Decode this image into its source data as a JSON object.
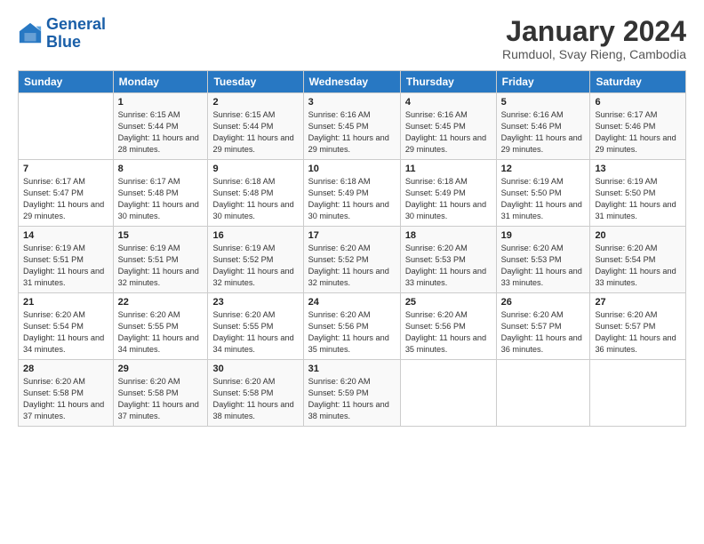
{
  "logo": {
    "line1": "General",
    "line2": "Blue"
  },
  "title": "January 2024",
  "subtitle": "Rumduol, Svay Rieng, Cambodia",
  "days_header": [
    "Sunday",
    "Monday",
    "Tuesday",
    "Wednesday",
    "Thursday",
    "Friday",
    "Saturday"
  ],
  "weeks": [
    [
      {
        "num": "",
        "sunrise": "",
        "sunset": "",
        "daylight": ""
      },
      {
        "num": "1",
        "sunrise": "Sunrise: 6:15 AM",
        "sunset": "Sunset: 5:44 PM",
        "daylight": "Daylight: 11 hours and 28 minutes."
      },
      {
        "num": "2",
        "sunrise": "Sunrise: 6:15 AM",
        "sunset": "Sunset: 5:44 PM",
        "daylight": "Daylight: 11 hours and 29 minutes."
      },
      {
        "num": "3",
        "sunrise": "Sunrise: 6:16 AM",
        "sunset": "Sunset: 5:45 PM",
        "daylight": "Daylight: 11 hours and 29 minutes."
      },
      {
        "num": "4",
        "sunrise": "Sunrise: 6:16 AM",
        "sunset": "Sunset: 5:45 PM",
        "daylight": "Daylight: 11 hours and 29 minutes."
      },
      {
        "num": "5",
        "sunrise": "Sunrise: 6:16 AM",
        "sunset": "Sunset: 5:46 PM",
        "daylight": "Daylight: 11 hours and 29 minutes."
      },
      {
        "num": "6",
        "sunrise": "Sunrise: 6:17 AM",
        "sunset": "Sunset: 5:46 PM",
        "daylight": "Daylight: 11 hours and 29 minutes."
      }
    ],
    [
      {
        "num": "7",
        "sunrise": "Sunrise: 6:17 AM",
        "sunset": "Sunset: 5:47 PM",
        "daylight": "Daylight: 11 hours and 29 minutes."
      },
      {
        "num": "8",
        "sunrise": "Sunrise: 6:17 AM",
        "sunset": "Sunset: 5:48 PM",
        "daylight": "Daylight: 11 hours and 30 minutes."
      },
      {
        "num": "9",
        "sunrise": "Sunrise: 6:18 AM",
        "sunset": "Sunset: 5:48 PM",
        "daylight": "Daylight: 11 hours and 30 minutes."
      },
      {
        "num": "10",
        "sunrise": "Sunrise: 6:18 AM",
        "sunset": "Sunset: 5:49 PM",
        "daylight": "Daylight: 11 hours and 30 minutes."
      },
      {
        "num": "11",
        "sunrise": "Sunrise: 6:18 AM",
        "sunset": "Sunset: 5:49 PM",
        "daylight": "Daylight: 11 hours and 30 minutes."
      },
      {
        "num": "12",
        "sunrise": "Sunrise: 6:19 AM",
        "sunset": "Sunset: 5:50 PM",
        "daylight": "Daylight: 11 hours and 31 minutes."
      },
      {
        "num": "13",
        "sunrise": "Sunrise: 6:19 AM",
        "sunset": "Sunset: 5:50 PM",
        "daylight": "Daylight: 11 hours and 31 minutes."
      }
    ],
    [
      {
        "num": "14",
        "sunrise": "Sunrise: 6:19 AM",
        "sunset": "Sunset: 5:51 PM",
        "daylight": "Daylight: 11 hours and 31 minutes."
      },
      {
        "num": "15",
        "sunrise": "Sunrise: 6:19 AM",
        "sunset": "Sunset: 5:51 PM",
        "daylight": "Daylight: 11 hours and 32 minutes."
      },
      {
        "num": "16",
        "sunrise": "Sunrise: 6:19 AM",
        "sunset": "Sunset: 5:52 PM",
        "daylight": "Daylight: 11 hours and 32 minutes."
      },
      {
        "num": "17",
        "sunrise": "Sunrise: 6:20 AM",
        "sunset": "Sunset: 5:52 PM",
        "daylight": "Daylight: 11 hours and 32 minutes."
      },
      {
        "num": "18",
        "sunrise": "Sunrise: 6:20 AM",
        "sunset": "Sunset: 5:53 PM",
        "daylight": "Daylight: 11 hours and 33 minutes."
      },
      {
        "num": "19",
        "sunrise": "Sunrise: 6:20 AM",
        "sunset": "Sunset: 5:53 PM",
        "daylight": "Daylight: 11 hours and 33 minutes."
      },
      {
        "num": "20",
        "sunrise": "Sunrise: 6:20 AM",
        "sunset": "Sunset: 5:54 PM",
        "daylight": "Daylight: 11 hours and 33 minutes."
      }
    ],
    [
      {
        "num": "21",
        "sunrise": "Sunrise: 6:20 AM",
        "sunset": "Sunset: 5:54 PM",
        "daylight": "Daylight: 11 hours and 34 minutes."
      },
      {
        "num": "22",
        "sunrise": "Sunrise: 6:20 AM",
        "sunset": "Sunset: 5:55 PM",
        "daylight": "Daylight: 11 hours and 34 minutes."
      },
      {
        "num": "23",
        "sunrise": "Sunrise: 6:20 AM",
        "sunset": "Sunset: 5:55 PM",
        "daylight": "Daylight: 11 hours and 34 minutes."
      },
      {
        "num": "24",
        "sunrise": "Sunrise: 6:20 AM",
        "sunset": "Sunset: 5:56 PM",
        "daylight": "Daylight: 11 hours and 35 minutes."
      },
      {
        "num": "25",
        "sunrise": "Sunrise: 6:20 AM",
        "sunset": "Sunset: 5:56 PM",
        "daylight": "Daylight: 11 hours and 35 minutes."
      },
      {
        "num": "26",
        "sunrise": "Sunrise: 6:20 AM",
        "sunset": "Sunset: 5:57 PM",
        "daylight": "Daylight: 11 hours and 36 minutes."
      },
      {
        "num": "27",
        "sunrise": "Sunrise: 6:20 AM",
        "sunset": "Sunset: 5:57 PM",
        "daylight": "Daylight: 11 hours and 36 minutes."
      }
    ],
    [
      {
        "num": "28",
        "sunrise": "Sunrise: 6:20 AM",
        "sunset": "Sunset: 5:58 PM",
        "daylight": "Daylight: 11 hours and 37 minutes."
      },
      {
        "num": "29",
        "sunrise": "Sunrise: 6:20 AM",
        "sunset": "Sunset: 5:58 PM",
        "daylight": "Daylight: 11 hours and 37 minutes."
      },
      {
        "num": "30",
        "sunrise": "Sunrise: 6:20 AM",
        "sunset": "Sunset: 5:58 PM",
        "daylight": "Daylight: 11 hours and 38 minutes."
      },
      {
        "num": "31",
        "sunrise": "Sunrise: 6:20 AM",
        "sunset": "Sunset: 5:59 PM",
        "daylight": "Daylight: 11 hours and 38 minutes."
      },
      {
        "num": "",
        "sunrise": "",
        "sunset": "",
        "daylight": ""
      },
      {
        "num": "",
        "sunrise": "",
        "sunset": "",
        "daylight": ""
      },
      {
        "num": "",
        "sunrise": "",
        "sunset": "",
        "daylight": ""
      }
    ]
  ]
}
